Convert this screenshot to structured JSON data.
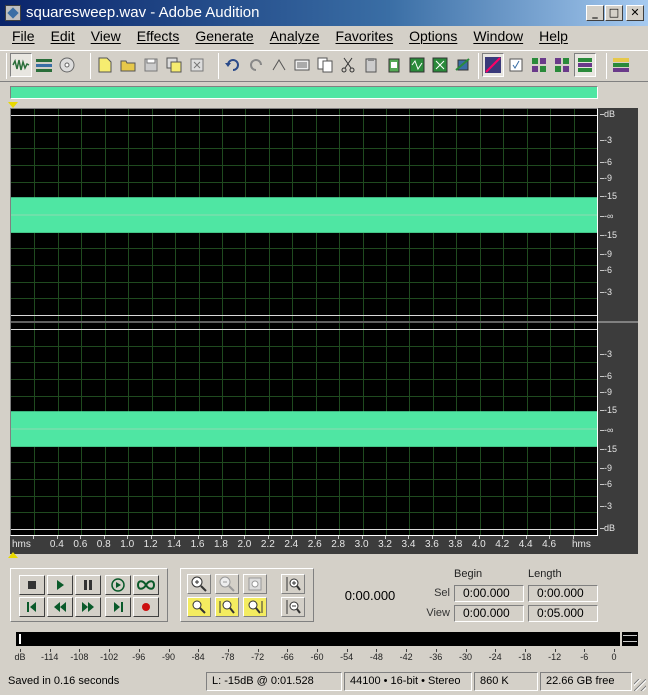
{
  "window": {
    "title": "squaresweep.wav - Adobe Audition",
    "controls": [
      "minimize",
      "maximize",
      "close"
    ],
    "minimize_glyph": "_",
    "maximize_glyph": "□",
    "close_glyph": "✕"
  },
  "menu": [
    "File",
    "Edit",
    "View",
    "Effects",
    "Generate",
    "Analyze",
    "Favorites",
    "Options",
    "Window",
    "Help"
  ],
  "toolbar": {
    "groups": [
      [
        "edit-view-icon",
        "multitrack-view-icon",
        "cd-project-icon"
      ],
      [
        "new-file-icon",
        "open-file-icon",
        "save-icon",
        "save-all-icon",
        "close-file-icon"
      ],
      [
        "undo-icon",
        "redo-icon",
        "repeat-last-icon",
        "copy-icon",
        "copy-to-new-icon",
        "cut-icon",
        "paste-icon",
        "paste-to-new-icon",
        "mix-paste-icon",
        "trim-icon",
        "crop-icon"
      ],
      [
        "spectral-view-icon",
        "frequency-analysis-icon",
        "grid-view-icon",
        "horizontal-tile-icon",
        "vertical-tile-icon"
      ],
      [
        "workspace-icon"
      ]
    ]
  },
  "waveform": {
    "colors": {
      "background": "#000000",
      "wave": "#4fe6a3",
      "grid": "#1f4a1f",
      "centerline": "#8fd9b0",
      "boundary": "#d8d8d8"
    },
    "channels": 2,
    "db_labels_channel": [
      "dB",
      "-3",
      "-6",
      "-9",
      "-15",
      "-∞",
      "-15",
      "-9",
      "-6",
      "-3"
    ],
    "db_labels_channel2": [
      "-3",
      "-6",
      "-9",
      "-15",
      "-∞",
      "-15",
      "-9",
      "-6",
      "-3",
      "dB"
    ],
    "ruler_unit": "hms",
    "ruler_labels": [
      "0.4",
      "0.6",
      "0.8",
      "1.0",
      "1.2",
      "1.4",
      "1.6",
      "1.8",
      "2.0",
      "2.2",
      "2.4",
      "2.6",
      "2.8",
      "3.0",
      "3.2",
      "3.4",
      "3.6",
      "3.8",
      "4.0",
      "4.2",
      "4.4",
      "4.6"
    ],
    "ruler_unit_right": "hms",
    "signal_level_db": -15
  },
  "transport": {
    "buttons": [
      "stop-icon",
      "play-icon",
      "pause-icon",
      "play-to-end-icon",
      "loop-icon",
      "go-to-start-icon",
      "rewind-icon",
      "fast-forward-icon",
      "go-to-end-icon",
      "record-icon"
    ]
  },
  "zoom": {
    "buttons": [
      "zoom-in-icon",
      "zoom-out-icon",
      "zoom-full-icon",
      "zoom-in-vertical-icon",
      "zoom-to-selection-icon",
      "zoom-left-icon",
      "zoom-right-icon",
      "zoom-out-vertical-icon"
    ]
  },
  "time_display": "0:00.000",
  "selection": {
    "begin_header": "Begin",
    "length_header": "Length",
    "sel_label": "Sel",
    "view_label": "View",
    "sel_begin": "0:00.000",
    "sel_length": "0:00.000",
    "view_begin": "0:00.000",
    "view_length": "0:05.000"
  },
  "level_meter": {
    "labels": [
      "dB",
      "-114",
      "-108",
      "-102",
      "-96",
      "-90",
      "-84",
      "-78",
      "-72",
      "-66",
      "-60",
      "-54",
      "-48",
      "-42",
      "-36",
      "-30",
      "-24",
      "-18",
      "-12",
      "-6",
      "0"
    ]
  },
  "status": {
    "message": "Saved in 0.16 seconds",
    "cursor": "L: -15dB @   0:01.528",
    "format": "44100 • 16-bit • Stereo",
    "size": "860 K",
    "free": "22.66 GB free"
  }
}
